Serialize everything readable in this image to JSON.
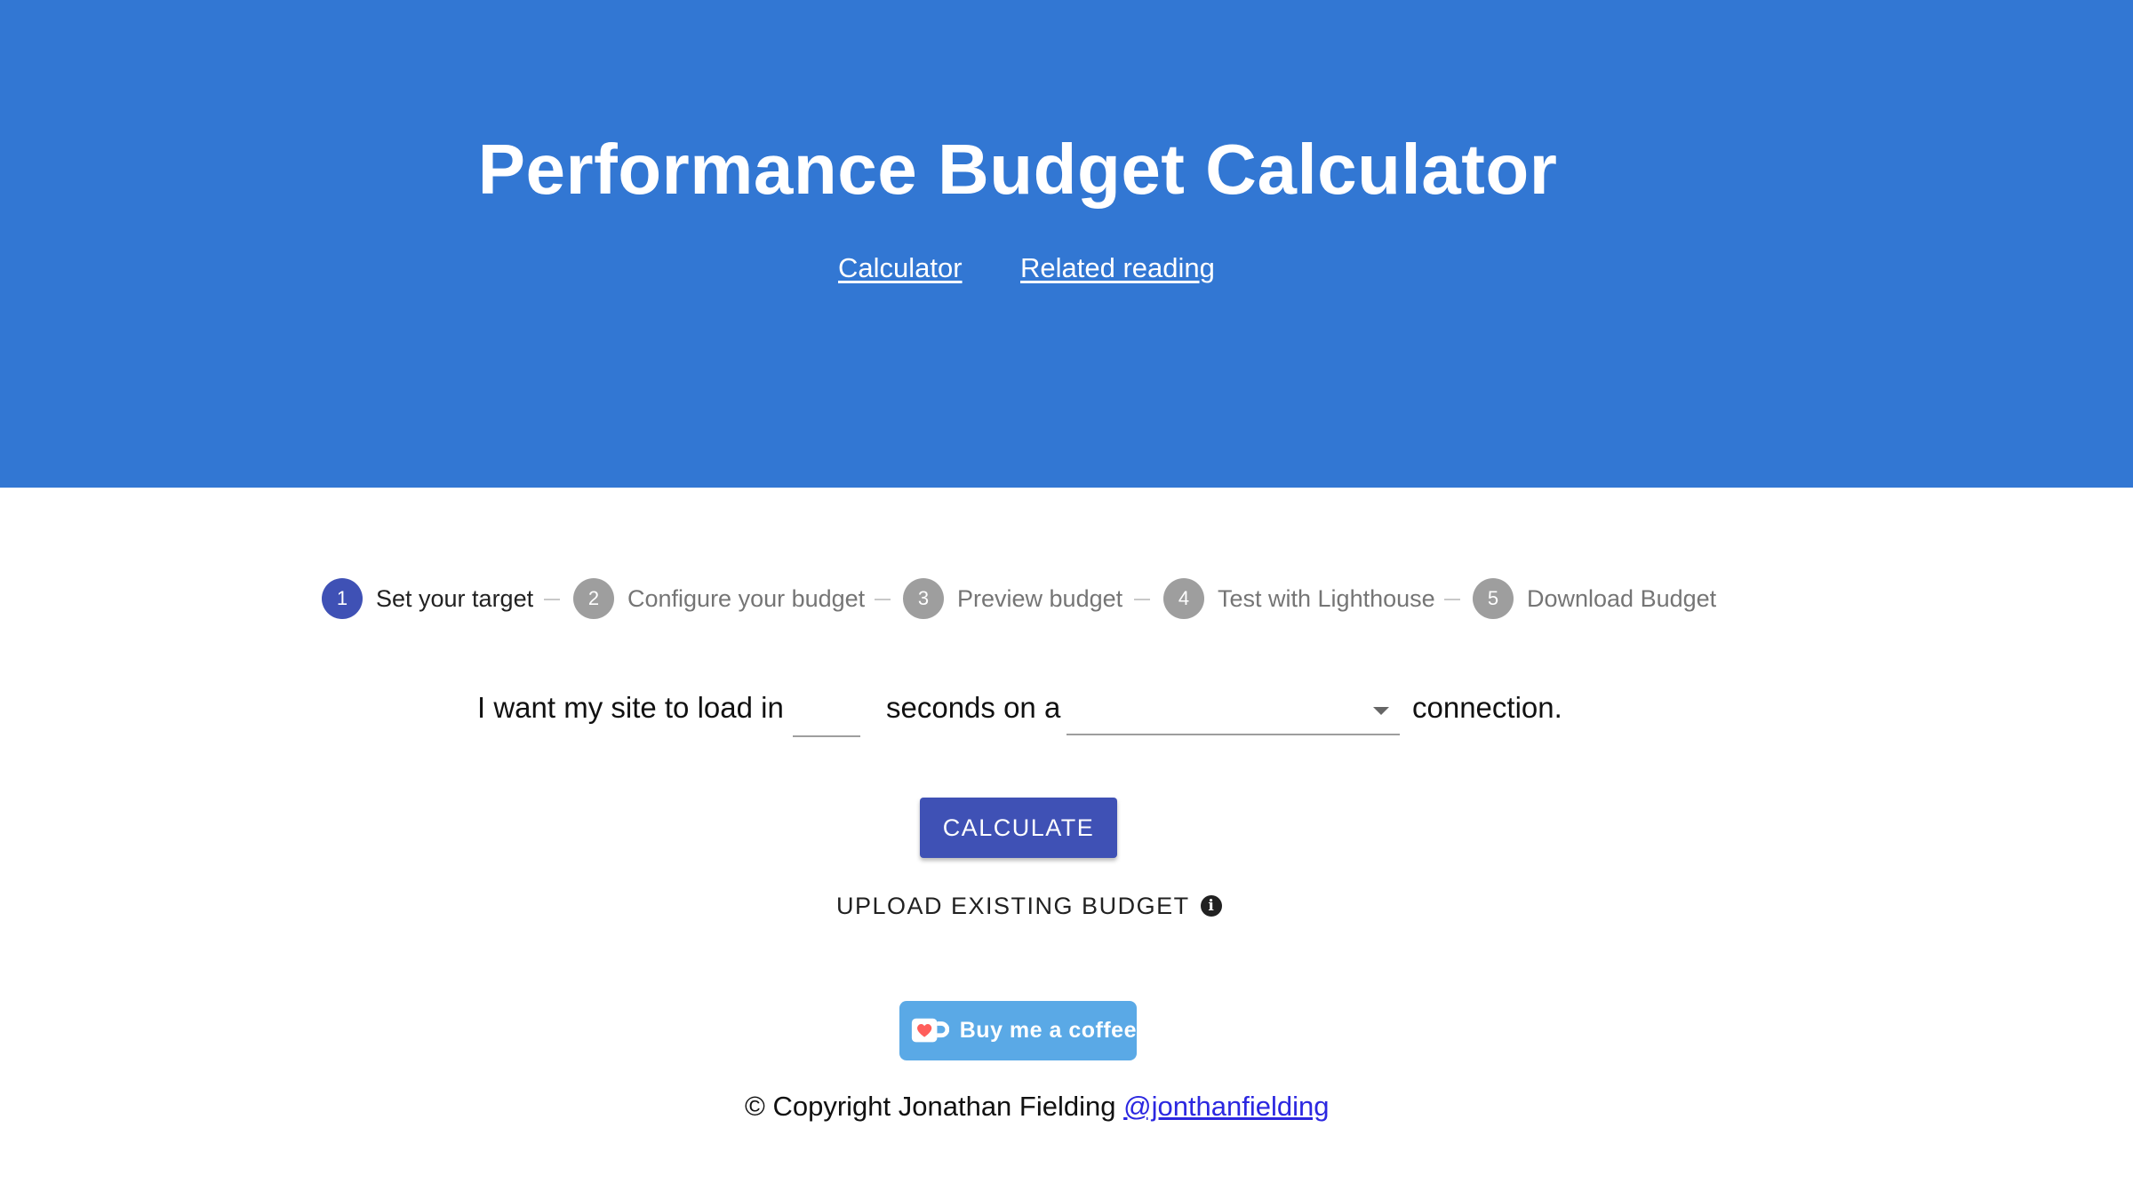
{
  "header": {
    "title": "Performance Budget Calculator",
    "nav": [
      {
        "label": "Calculator"
      },
      {
        "label": "Related reading"
      }
    ]
  },
  "stepper": {
    "steps": [
      {
        "number": "1",
        "label": "Set your target",
        "active": true
      },
      {
        "number": "2",
        "label": "Configure your budget",
        "active": false
      },
      {
        "number": "3",
        "label": "Preview budget",
        "active": false
      },
      {
        "number": "4",
        "label": "Test with Lighthouse",
        "active": false
      },
      {
        "number": "5",
        "label": "Download Budget",
        "active": false
      }
    ]
  },
  "form": {
    "text_before": "I want my site to load in",
    "seconds_value": "",
    "text_middle": "seconds on a",
    "connection_value": "",
    "text_after": "connection."
  },
  "actions": {
    "calculate_label": "CALCULATE",
    "upload_label": "UPLOAD EXISTING BUDGET",
    "info_icon": "info-icon"
  },
  "coffee": {
    "label": "Buy me a coffee",
    "icon": "coffee-cup-heart-icon"
  },
  "footer": {
    "copyright": "© Copyright Jonathan Fielding",
    "handle": "@jonthanfielding"
  },
  "colors": {
    "hero_bg": "#3277d3",
    "primary": "#3f51b5",
    "step_inactive": "#9e9e9e",
    "coffee_bg": "#5aa9e6"
  }
}
